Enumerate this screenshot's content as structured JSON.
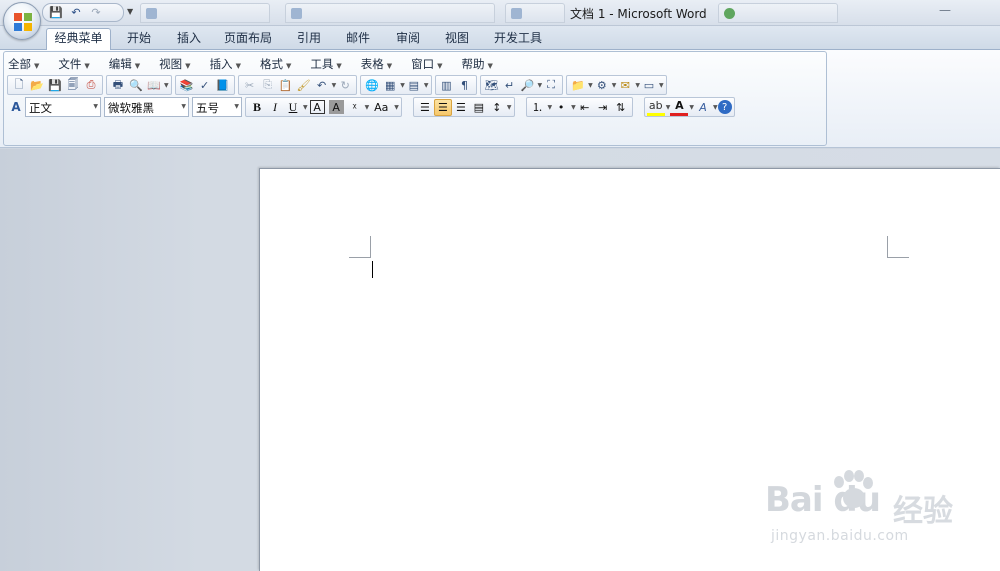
{
  "window": {
    "title": "文档 1 - Microsoft Word",
    "minimize_glyph": "—"
  },
  "quick_access": {
    "items": [
      {
        "name": "save-icon",
        "glyph": "💾"
      },
      {
        "name": "undo-icon",
        "glyph": "↶"
      },
      {
        "name": "redo-icon",
        "glyph": "↷"
      }
    ],
    "dropdown_glyph": "▼"
  },
  "tabs": [
    "经典菜单",
    "开始",
    "插入",
    "页面布局",
    "引用",
    "邮件",
    "审阅",
    "视图",
    "开发工具"
  ],
  "menubar": [
    "全部",
    "文件",
    "编辑",
    "视图",
    "插入",
    "格式",
    "工具",
    "表格",
    "窗口",
    "帮助"
  ],
  "formatting": {
    "style": "正文",
    "font": "微软雅黑",
    "size": "五号",
    "bold": "B",
    "italic": "I",
    "underline": "U",
    "char_border": "A",
    "char_shading": "A",
    "change_case": "Aa"
  },
  "watermark": {
    "logo": "Bai du",
    "cn": "经验",
    "url": "jingyan.baidu.com"
  },
  "colors": {
    "accent": "#2b579a",
    "highlight": "#ffff00",
    "font_color": "#e02020",
    "active": "#f6c76a"
  }
}
